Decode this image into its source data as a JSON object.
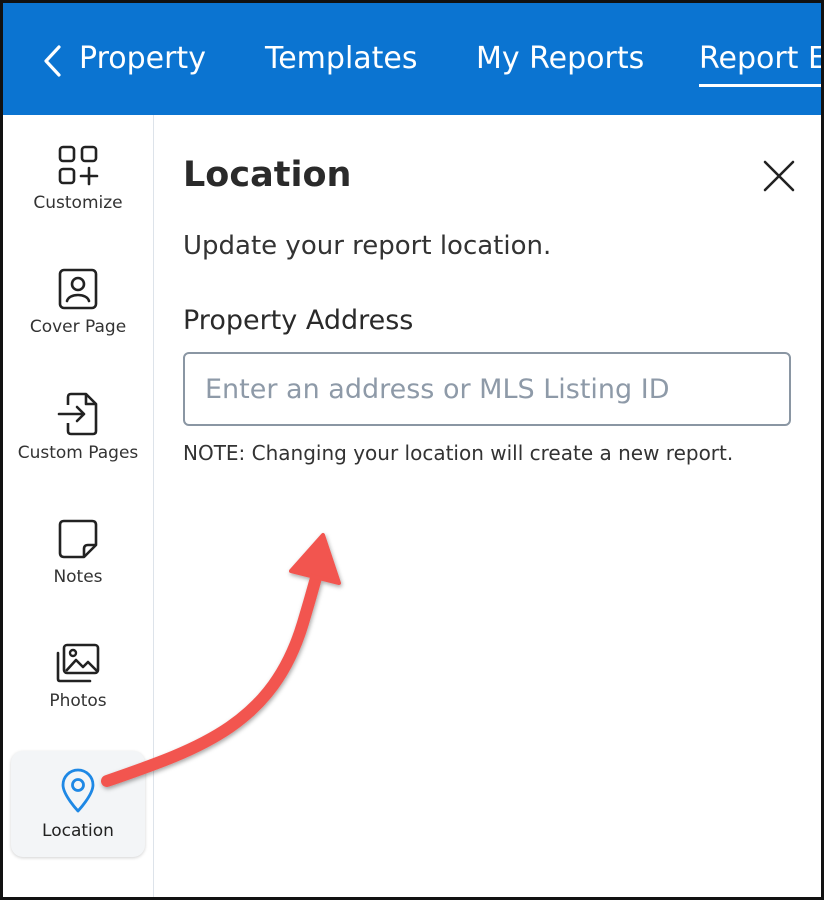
{
  "nav": {
    "back_icon": "chevron-left-icon",
    "items": [
      {
        "label": "Property"
      },
      {
        "label": "Templates"
      },
      {
        "label": "My Reports"
      },
      {
        "label": "Report Ed",
        "active": true
      }
    ],
    "bar_color": "#0b74d1"
  },
  "sidebar": {
    "items": [
      {
        "label": "Customize",
        "icon": "grid-plus-icon"
      },
      {
        "label": "Cover Page",
        "icon": "user-card-icon"
      },
      {
        "label": "Custom Pages",
        "icon": "file-import-icon"
      },
      {
        "label": "Notes",
        "icon": "sticky-note-icon"
      },
      {
        "label": "Photos",
        "icon": "photos-icon"
      },
      {
        "label": "Location",
        "icon": "map-pin-icon",
        "active": true
      }
    ],
    "active_color": "#1e88e5"
  },
  "panel": {
    "title": "Location",
    "close_icon": "close-icon",
    "description": "Update your report location.",
    "field_label": "Property Address",
    "input_placeholder": "Enter an address or MLS Listing ID",
    "input_value": "",
    "note": "NOTE: Changing your location will create a new report."
  },
  "annotation": {
    "icon": "curved-arrow-icon",
    "color": "#f2554f"
  }
}
